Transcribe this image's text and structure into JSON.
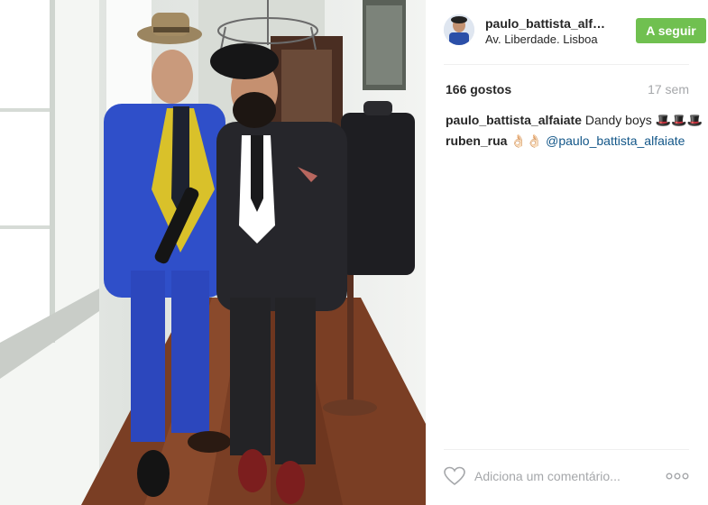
{
  "post": {
    "author": {
      "username": "paulo_battista_alfaiate",
      "location": "Av. Liberdade. Lisboa",
      "follow_label": "A seguir"
    },
    "likes": "166 gostos",
    "time_ago": "17 sem",
    "comments": [
      {
        "user": "paulo_battista_alfaiate",
        "text": "Dandy boys 🎩🎩🎩"
      },
      {
        "user": "ruben_rua",
        "text": "👌🏻👌🏻",
        "mention": "@paulo_battista_alfaiate"
      }
    ],
    "add_comment_placeholder": "Adiciona um comentário...",
    "photo_icon": "photo-two-men-in-suits"
  },
  "colors": {
    "follow_button": "#70c050",
    "mention": "#125688",
    "muted": "#a5a7aa",
    "text": "#262626"
  }
}
